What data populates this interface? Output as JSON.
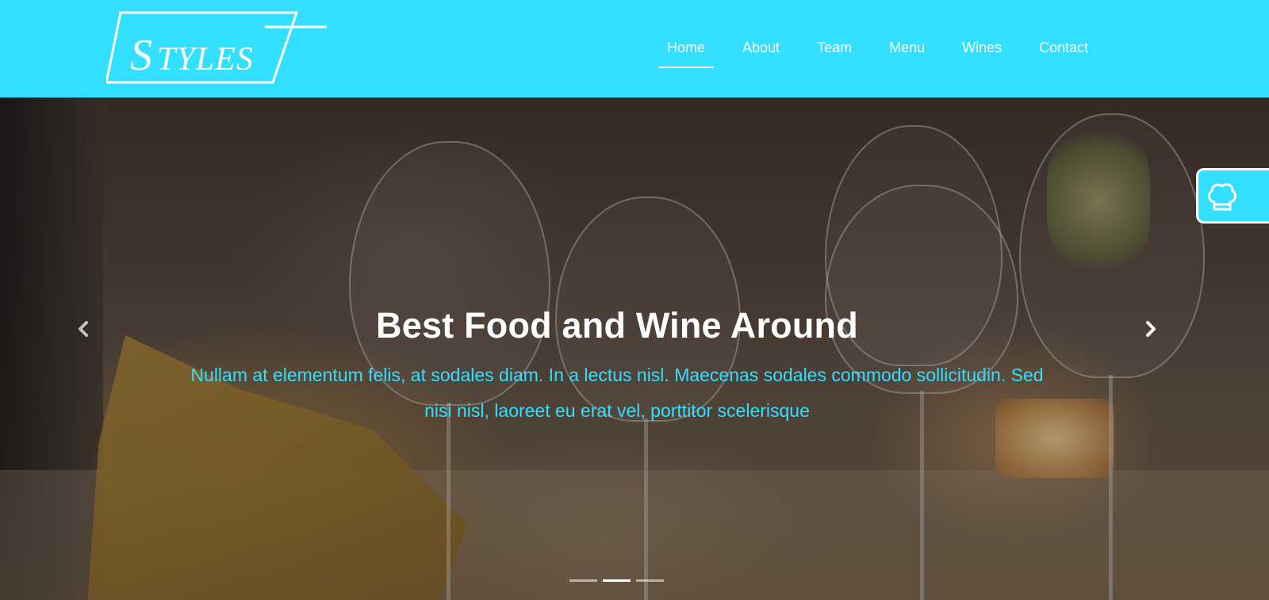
{
  "brand": {
    "logo_text": "Styles",
    "accent_color": "#33dfff"
  },
  "nav": {
    "items": [
      {
        "label": "Home",
        "active": true
      },
      {
        "label": "About",
        "active": false
      },
      {
        "label": "Team",
        "active": false
      },
      {
        "label": "Menu",
        "active": false
      },
      {
        "label": "Wines",
        "active": false
      },
      {
        "label": "Contact",
        "active": false
      }
    ]
  },
  "hero": {
    "title": "Best Food and Wine Around",
    "subtitle": "Nullam at elementum felis, at sodales diam. In a lectus nisl. Maecenas sodales commodo sollicitudin. Sed nisi nisl, laoreet eu erat vel, porttitor scelerisque",
    "prev_icon": "chevron-left-icon",
    "next_icon": "chevron-right-icon",
    "slide_count": 3,
    "active_slide": 2
  },
  "side_widget": {
    "icon": "chef-hat-icon"
  }
}
